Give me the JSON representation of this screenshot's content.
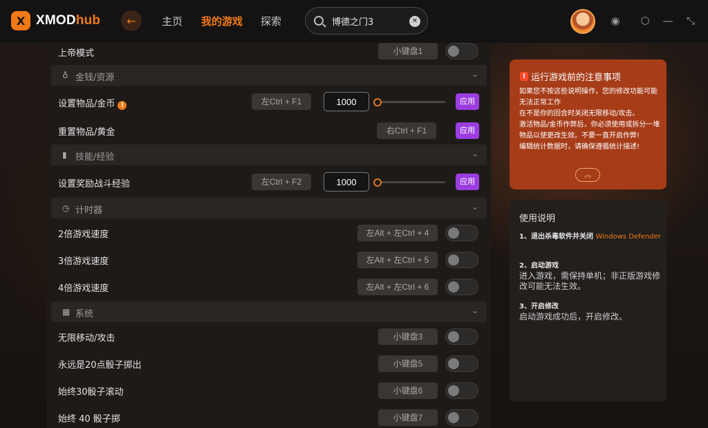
{
  "header": {
    "logo_mark": "X",
    "logo_text": "XMOD",
    "logo_accent": "hub",
    "back_icon": "arrow-left-icon",
    "nav": [
      {
        "label": "主页",
        "active": false
      },
      {
        "label": "我的游戏",
        "active": true
      },
      {
        "label": "探索",
        "active": false
      }
    ],
    "search": {
      "value": "博德之门3"
    },
    "icons": [
      "bell-icon",
      "settings-icon",
      "minimize-icon",
      "shrink-icon"
    ]
  },
  "panel": {
    "top_row": {
      "label": "上帝模式",
      "hotkey": "小键盘1"
    },
    "sections": [
      {
        "icon": "money-bag-icon",
        "title": "金钱/资源"
      },
      {
        "icon": "bar-chart-icon",
        "title": "技能/经验"
      },
      {
        "icon": "timer-icon",
        "title": "计时器"
      },
      {
        "icon": "grid-icon",
        "title": "系统"
      }
    ],
    "money_rows": [
      {
        "label": "设置物品/金币",
        "hotkey": "左Ctrl + F1",
        "value": "1000",
        "apply": "应用"
      },
      {
        "label": "重置物品/黄金",
        "hotkey": "右Ctrl + F1",
        "apply": "应用"
      }
    ],
    "exp_row": {
      "label": "设置奖励战斗经验",
      "hotkey": "左Ctrl + F2",
      "value": "1000",
      "apply": "应用"
    },
    "timer_rows": [
      {
        "label": "2倍游戏速度",
        "hotkey": "左Alt + 左Ctrl + 4"
      },
      {
        "label": "3倍游戏速度",
        "hotkey": "左Alt + 左Ctrl + 5"
      },
      {
        "label": "4倍游戏速度",
        "hotkey": "左Alt + 左Ctrl + 6"
      }
    ],
    "system_rows": [
      {
        "label": "无限移动/攻击",
        "hotkey": "小键盘3"
      },
      {
        "label": "永远是20点骰子掷出",
        "hotkey": "小键盘5"
      },
      {
        "label": "始终30骰子滚动",
        "hotkey": "小键盘6"
      },
      {
        "label": "始终 40 骰子掷",
        "hotkey": "小键盘7"
      }
    ]
  },
  "notice": {
    "title": "运行游戏前的注意事项",
    "lines": [
      "如果您不按这些说明操作，您的修改功能可能无法正常工作",
      "在不是你的回合时关闭无限移动/攻击。",
      "激活物品/金币作弊后，你必须使用或拆分一堆物品以使更改生效。不要一直开启作弊!",
      "编辑统计数据时，请确保遵循统计描述!"
    ],
    "collapse_icon": "chevron-up-double-icon"
  },
  "guide": {
    "title": "使用说明",
    "steps": [
      {
        "head": "1、退出杀毒软件并关闭",
        "highlight": "Windows Defender",
        "body": ""
      },
      {
        "head": "2、启动游戏",
        "highlight": "",
        "body": "进入游戏，需保持单机；非正版游戏修改可能无法生效。"
      },
      {
        "head": "3、开启修改",
        "highlight": "",
        "body": "启动游戏成功后，开启修改。"
      }
    ]
  },
  "colors": {
    "accent": "#f07a16",
    "apply": "#9b3de0",
    "notice_bg": "#a63c18"
  }
}
